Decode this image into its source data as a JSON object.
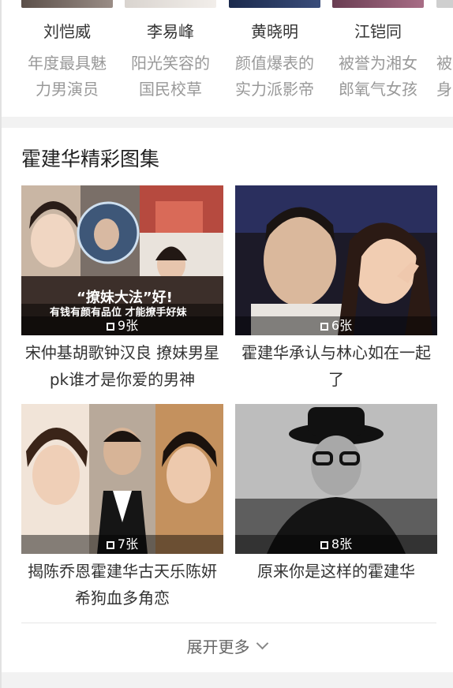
{
  "related_stars": [
    {
      "name": "刘恺威",
      "desc": "年度最具魅力男演员"
    },
    {
      "name": "李易峰",
      "desc": "阳光笑容的国民校草"
    },
    {
      "name": "黄晓明",
      "desc": "颜值爆表的实力派影帝"
    },
    {
      "name": "江铠同",
      "desc": "被誉为湘女郎氧气女孩"
    },
    {
      "name": "",
      "desc": "被身"
    }
  ],
  "gallery": {
    "title": "霍建华精彩图集",
    "cards": [
      {
        "title": "宋仲基胡歌钟汉良 撩妹男星pk谁才是你爱的男神",
        "count": "9张",
        "overlay_text": "“撩妹大法”好!",
        "overlay_sub": "有钱有颜有品位 才能撩手好妹"
      },
      {
        "title": "霍建华承认与林心如在一起了",
        "count": "6张"
      },
      {
        "title": "揭陈乔恩霍建华古天乐陈妍希狗血多角恋",
        "count": "7张"
      },
      {
        "title": "原来你是这样的霍建华",
        "count": "8张"
      }
    ],
    "more_label": "展开更多"
  }
}
